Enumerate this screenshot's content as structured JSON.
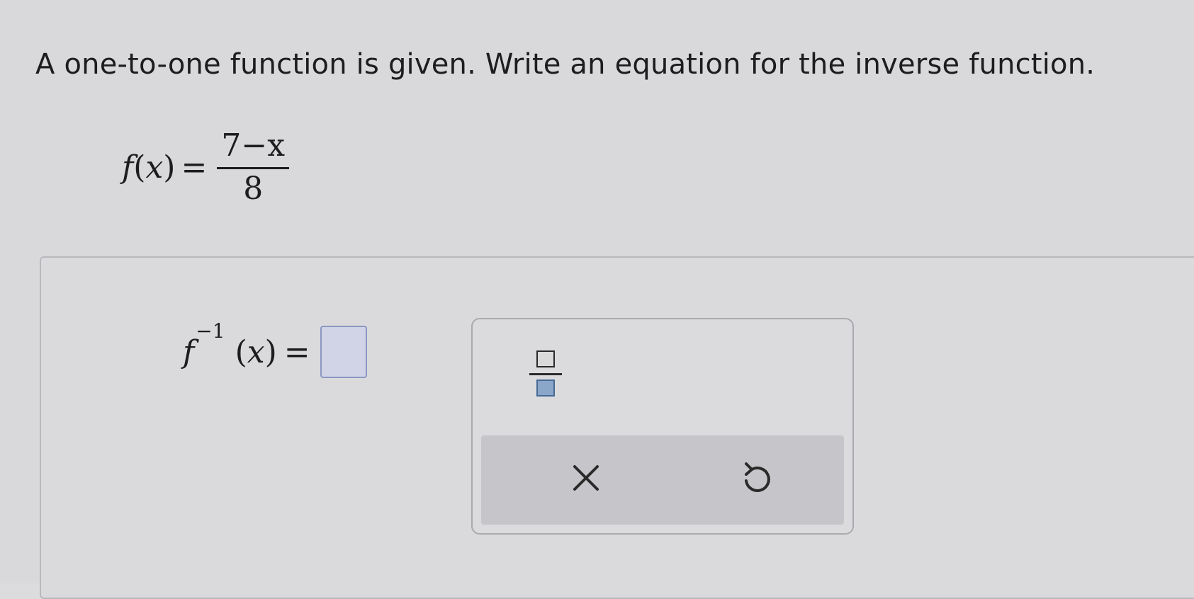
{
  "question": {
    "text": "A one-to-one function is given. Write an equation for the inverse function."
  },
  "given_function": {
    "name": "f",
    "variable": "x",
    "equals": "=",
    "numerator": "7−x",
    "denominator": "8"
  },
  "inverse_function": {
    "name": "f",
    "superscript": "−1",
    "variable": "x",
    "equals": "=",
    "answer_value": ""
  },
  "palette": {
    "fraction_icon": "fraction-template-icon",
    "clear_icon": "close-icon",
    "undo_icon": "undo-icon",
    "icon_color": "#2a2a2a"
  }
}
